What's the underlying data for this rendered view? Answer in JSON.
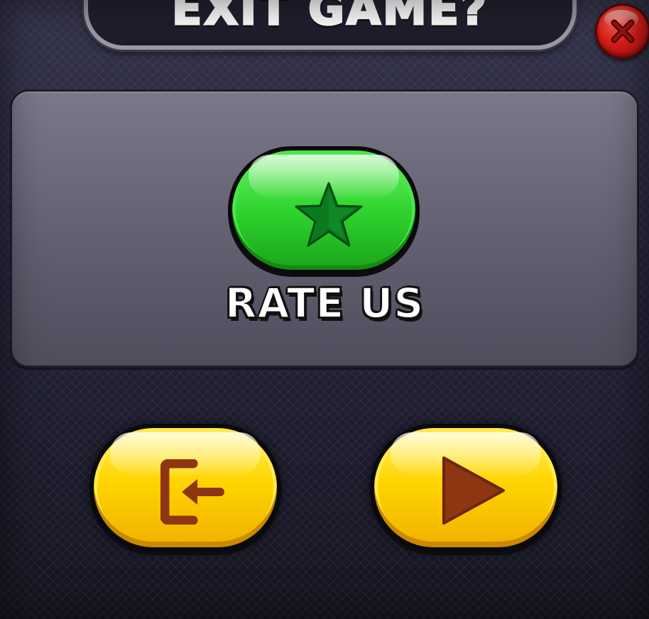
{
  "title": {
    "text": "EXIT GAME?"
  },
  "close_button": {
    "icon": "close-x-icon",
    "color": "#e0201a"
  },
  "rate_panel": {
    "rate_button": {
      "icon": "star-icon",
      "color": "#2fd42e"
    },
    "label": "RATE US"
  },
  "actions": {
    "exit_button": {
      "icon": "exit-door-icon",
      "color": "#ffd500"
    },
    "play_button": {
      "icon": "play-icon",
      "color": "#ffd500"
    }
  },
  "colors": {
    "background": "#23222f",
    "panel": "#6b6a7b",
    "icon_brown": "#8e3512",
    "star_green": "#0b7a1e"
  }
}
